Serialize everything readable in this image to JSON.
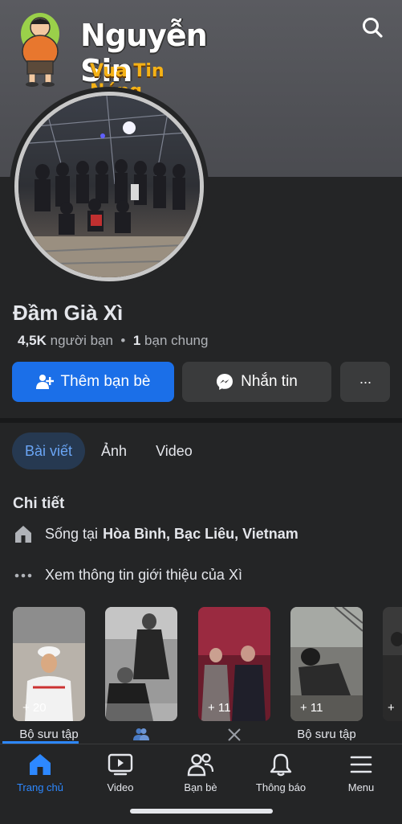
{
  "header": {
    "brand_name": "Nguyễn Sin",
    "brand_tagline": "Vua Tin Nóng",
    "search_icon": "search-icon"
  },
  "profile": {
    "name": "Đầm Già Xì",
    "friends_count": "4,5K",
    "friends_label": "người bạn",
    "separator": "•",
    "mutual_count": "1",
    "mutual_label": "bạn chung"
  },
  "actions": {
    "add_friend": "Thêm bạn bè",
    "message": "Nhắn tin",
    "more": "···"
  },
  "tabs": [
    {
      "label": "Bài viết",
      "active": true
    },
    {
      "label": "Ảnh",
      "active": false
    },
    {
      "label": "Video",
      "active": false
    }
  ],
  "details": {
    "title": "Chi tiết",
    "lives_prefix": "Sống tại",
    "lives_place": "Hòa Bình, Bạc Liêu, Vietnam",
    "see_intro": "Xem thông tin giới thiệu của Xì"
  },
  "collections": [
    {
      "count": "+ 20",
      "label": "Bộ sưu tập",
      "label_icon": ""
    },
    {
      "count": "",
      "label": "",
      "label_icon": "people-icon"
    },
    {
      "count": "+ 11",
      "label": "",
      "label_icon": "swords-icon"
    },
    {
      "count": "+ 11",
      "label": "Bộ sưu tập",
      "label_icon": ""
    },
    {
      "count": "+",
      "label": "",
      "label_icon": ""
    }
  ],
  "bottom_nav": [
    {
      "label": "Trang chủ",
      "icon": "home-icon",
      "active": true
    },
    {
      "label": "Video",
      "icon": "video-icon",
      "active": false
    },
    {
      "label": "Bạn bè",
      "icon": "friends-icon",
      "active": false
    },
    {
      "label": "Thông báo",
      "icon": "bell-icon",
      "active": false
    },
    {
      "label": "Menu",
      "icon": "menu-icon",
      "active": false
    }
  ],
  "colors": {
    "background": "#242526",
    "accent": "#1b6fe8",
    "active_tab_text": "#6aa5f5",
    "brand_tagline": "#f5b216"
  }
}
